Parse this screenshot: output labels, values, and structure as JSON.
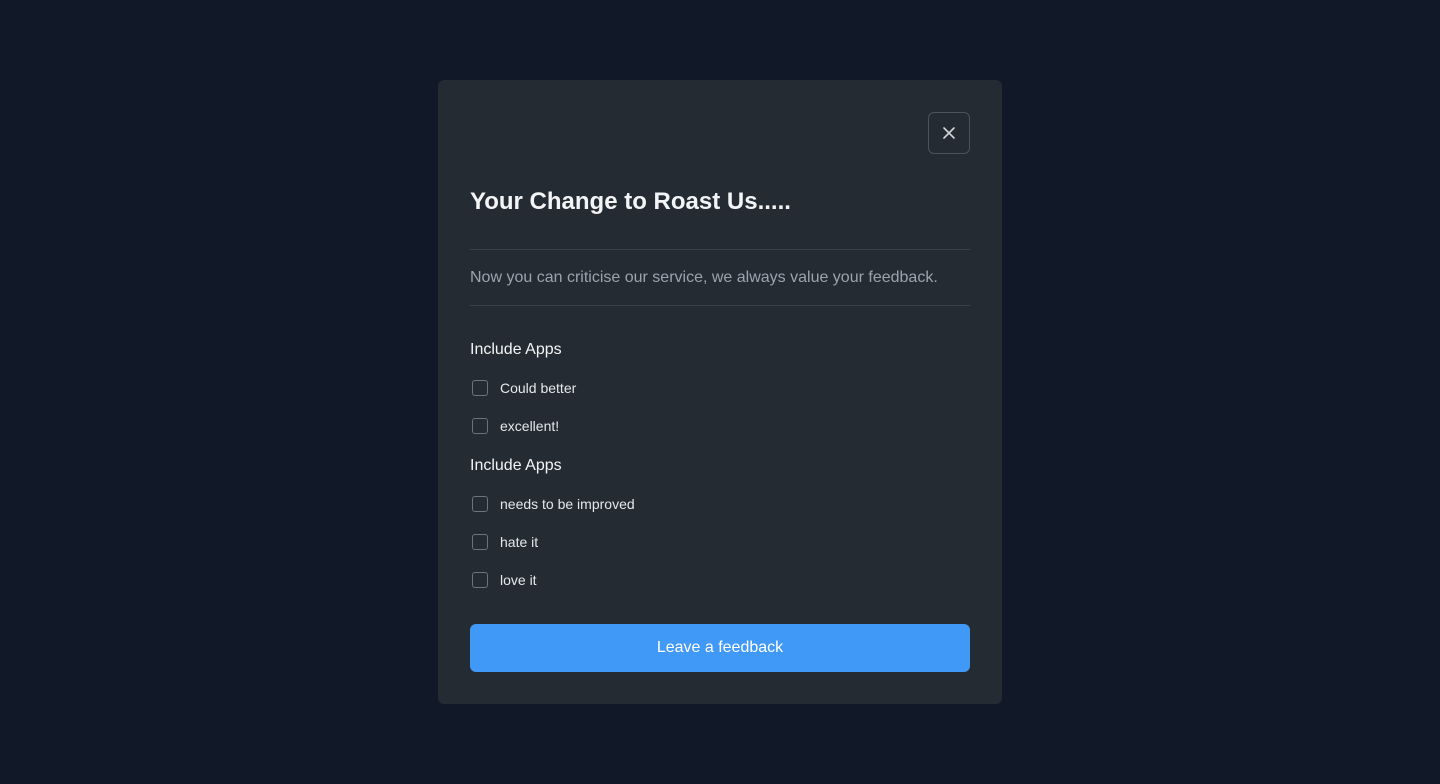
{
  "modal": {
    "title": "Your Change to Roast Us.....",
    "description": "Now you can criticise our service, we always value your feedback.",
    "close_icon": "close-icon",
    "groups": [
      {
        "title": "Include Apps",
        "options": [
          {
            "label": "Could better",
            "checked": false
          },
          {
            "label": "excellent!",
            "checked": false
          }
        ]
      },
      {
        "title": "Include Apps",
        "options": [
          {
            "label": "needs to be improved",
            "checked": false
          },
          {
            "label": "hate it",
            "checked": false
          },
          {
            "label": "love it",
            "checked": false
          }
        ]
      }
    ],
    "submit_label": "Leave a feedback"
  },
  "colors": {
    "background": "#111827",
    "modal": "#242B33",
    "accent": "#4199F7"
  }
}
